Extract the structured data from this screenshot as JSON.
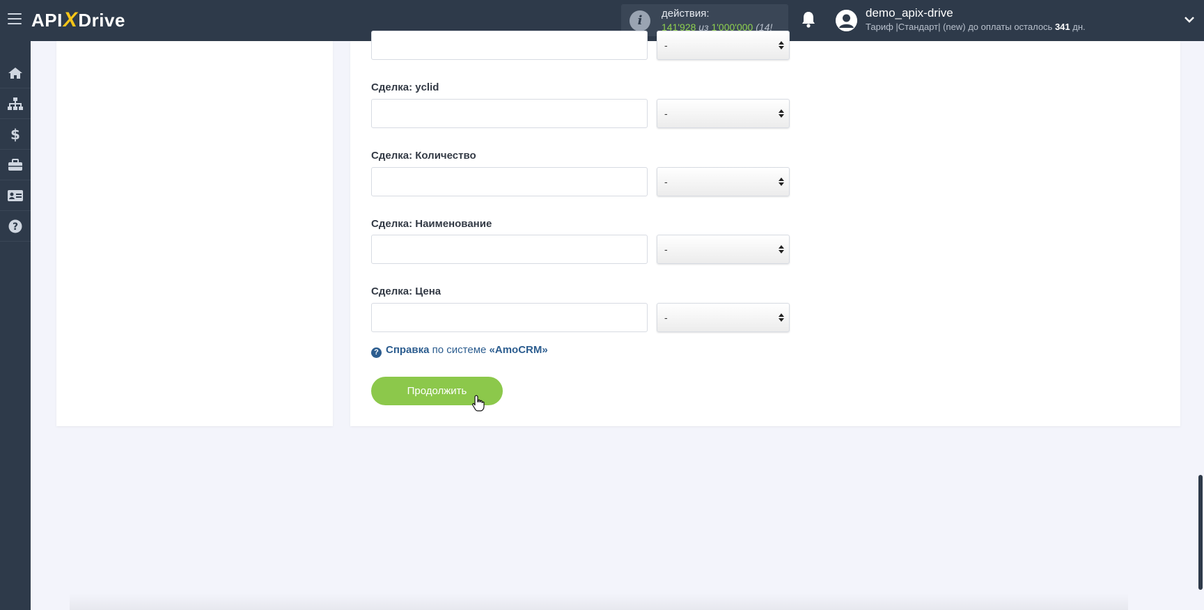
{
  "header": {
    "logo": {
      "api": "API",
      "x": "X",
      "drive": "Drive"
    },
    "actions": {
      "label": "действия:",
      "used": "141'928",
      "separator": " из ",
      "total": "1'000'000",
      "extra": " (14!"
    },
    "user": {
      "name": "demo_apix-drive",
      "tariff_prefix": "Тариф |Стандарт| (new) до оплаты осталось ",
      "days": "341",
      "tariff_suffix": " дн."
    }
  },
  "sidebar": {
    "items": [
      {
        "icon": "home-icon"
      },
      {
        "icon": "sitemap-icon"
      },
      {
        "icon": "dollar-icon"
      },
      {
        "icon": "briefcase-icon"
      },
      {
        "icon": "id-card-icon"
      },
      {
        "icon": "help-circle-icon"
      }
    ]
  },
  "form": {
    "fields": [
      {
        "label": "",
        "value": "",
        "select": "-"
      },
      {
        "label": "Сделка: yclid",
        "value": "",
        "select": "-"
      },
      {
        "label": "Сделка: Количество",
        "value": "",
        "select": "-"
      },
      {
        "label": "Сделка: Наименование",
        "value": "",
        "select": "-"
      },
      {
        "label": "Сделка: Цена",
        "value": "",
        "select": "-"
      }
    ],
    "help": {
      "strong": "Справка",
      "middle": " по системе ",
      "system": "«AmoCRM»"
    },
    "continue_label": "Продолжить"
  },
  "colors": {
    "topbar": "#2e3a4a",
    "accent_green": "#8cc84b",
    "link_blue": "#2c5d8f",
    "logo_x": "#f5c518"
  }
}
